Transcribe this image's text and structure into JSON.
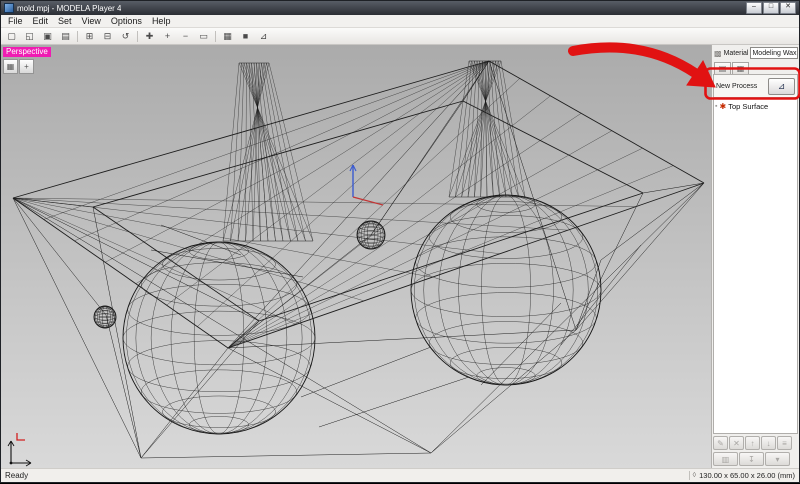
{
  "window": {
    "title": "mold.mpj - MODELA Player 4",
    "controls": {
      "minimize": "–",
      "maximize": "□",
      "close": "✕"
    }
  },
  "menu": {
    "items": [
      "File",
      "Edit",
      "Set",
      "View",
      "Options",
      "Help"
    ]
  },
  "toolbar": {
    "buttons": [
      {
        "name": "file-new",
        "glyph": "▢"
      },
      {
        "name": "file-open",
        "glyph": "◱"
      },
      {
        "name": "file-save",
        "glyph": "▣"
      },
      {
        "name": "print",
        "glyph": "▤"
      },
      {
        "name": "view-top",
        "glyph": "⊞"
      },
      {
        "name": "view-front",
        "glyph": "⊟"
      },
      {
        "name": "view-rotate",
        "glyph": "↺"
      },
      {
        "name": "pan",
        "glyph": "✚"
      },
      {
        "name": "zoom-in",
        "glyph": "+"
      },
      {
        "name": "zoom-out",
        "glyph": "−"
      },
      {
        "name": "zoom-fit",
        "glyph": "▭"
      },
      {
        "name": "wireframe-mode",
        "glyph": "▦"
      },
      {
        "name": "shaded-mode",
        "glyph": "■"
      },
      {
        "name": "axes-toggle",
        "glyph": "⊿"
      }
    ]
  },
  "viewport": {
    "view_label": "Perspective",
    "mini_buttons": [
      {
        "name": "grid-toggle",
        "glyph": "▦"
      },
      {
        "name": "origin-toggle",
        "glyph": "+"
      }
    ]
  },
  "side_panel": {
    "material": {
      "icon_glyph": "▩",
      "label": "Material",
      "value": "Modeling Wax",
      "arrow": "▾"
    },
    "tabs": [
      {
        "name": "process-tab",
        "glyph": "▤"
      },
      {
        "name": "model-tab",
        "glyph": "▦"
      }
    ],
    "new_process": {
      "label": "New Process",
      "button_glyph": "⊿"
    },
    "tree": {
      "grip_glyph": "▪",
      "icon_glyph": "✱",
      "items": [
        {
          "label": "Top Surface"
        }
      ]
    },
    "bottom": {
      "row1": [
        {
          "name": "edit-process",
          "glyph": "✎"
        },
        {
          "name": "delete-process",
          "glyph": "✕"
        },
        {
          "name": "move-up",
          "glyph": "↑"
        },
        {
          "name": "move-down",
          "glyph": "↓"
        },
        {
          "name": "process-list",
          "glyph": "≡"
        }
      ],
      "row2": [
        {
          "name": "preview-cut",
          "glyph": "▥"
        },
        {
          "name": "send-to-machine",
          "glyph": "↧"
        },
        {
          "name": "more-options",
          "glyph": "▾"
        }
      ]
    }
  },
  "status_bar": {
    "ready": "Ready",
    "size_icon_glyph": "◊",
    "dimensions": "130.00 x 65.00 x 26.00 (mm)"
  },
  "annotation": {
    "color": "#e11212"
  }
}
